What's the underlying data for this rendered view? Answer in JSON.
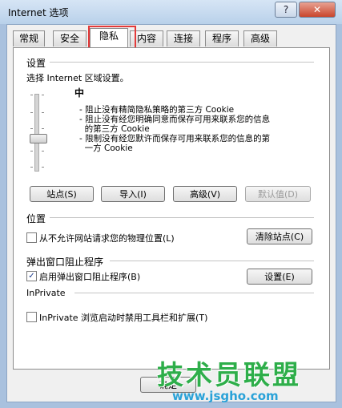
{
  "window": {
    "title": "Internet 选项",
    "help": "?",
    "close": "✕"
  },
  "tabs": [
    "常规",
    "安全",
    "隐私",
    "内容",
    "连接",
    "程序",
    "高级"
  ],
  "selected_tab": "隐私",
  "settings": {
    "header": "设置",
    "zone_prompt": "选择 Internet 区域设置。",
    "level": "中",
    "descriptions": [
      "- 阻止没有精简隐私策略的第三方 Cookie",
      "- 阻止没有经您明确同意而保存可用来联系您的信息",
      "  的第三方 Cookie",
      "- 限制没有经您默许而保存可用来联系您的信息的第",
      "  一方 Cookie"
    ],
    "buttons": {
      "sites": "站点(S)",
      "import": "导入(I)",
      "advanced": "高级(V)",
      "default": "默认值(D)"
    }
  },
  "location": {
    "header": "位置",
    "checkbox_label": "从不允许网站请求您的物理位置(L)",
    "checked": false,
    "clear_button": "清除站点(C)"
  },
  "popup": {
    "header": "弹出窗口阻止程序",
    "checkbox_label": "启用弹出窗口阻止程序(B)",
    "checked": true,
    "settings_button": "设置(E)"
  },
  "inprivate": {
    "header": "InPrivate",
    "checkbox_label": "InPrivate 浏览启动时禁用工具栏和扩展(T)",
    "checked": false
  },
  "footer": {
    "ok_partial": "确定"
  },
  "watermark": {
    "text": "技术员联盟",
    "url": "www.jsgho.com"
  },
  "colors": {
    "highlight": "#e33a3a",
    "watermark_green": "#2eae4a",
    "watermark_blue": "#2aa2d8"
  }
}
